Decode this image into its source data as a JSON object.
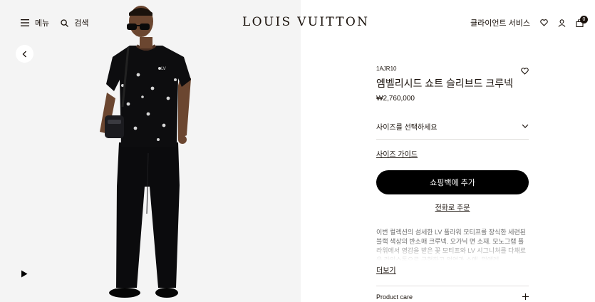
{
  "header": {
    "menu_label": "메뉴",
    "search_label": "검색",
    "logo": "LOUIS VUITTON",
    "client_service": "클라이언트 서비스",
    "bag_count": "0"
  },
  "product": {
    "sku": "1AJR10",
    "name": "엠벨리시드 쇼트 슬리브드 크루넥",
    "price": "₩2,760,000",
    "size_select": "사이즈를 선택하세요",
    "size_guide": "사이즈 가이드",
    "add_to_bag": "쇼핑백에 추가",
    "phone_order": "전화로 주문",
    "description": "이번 컬렉션의 섬세한 LV 플라워 모티프를 장식한 세련된 블랙 색상의 반소매 크루넥. 오가닉 면 소재. 모노그램 플라워에서 영감을 받은 꽃 모티프와 LV 시그니처를 다채로운 라인스톤으로 구현하고 엄연과 소매, 밑에레",
    "read_more": "더보기",
    "product_care": "Product care"
  },
  "colors": {
    "text": "#19110b",
    "button_bg": "#000000",
    "gallery_bg": "#f4f4f4"
  },
  "icons": [
    "hamburger-menu-icon",
    "search-icon",
    "heart-icon",
    "user-icon",
    "shopping-bag-icon",
    "chevron-left-icon",
    "play-icon",
    "chevron-down-icon",
    "plus-icon"
  ]
}
